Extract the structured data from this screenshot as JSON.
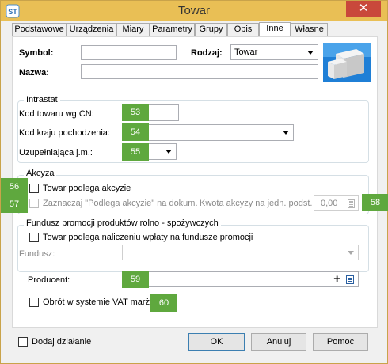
{
  "window": {
    "title": "Towar",
    "close_glyph": "✕",
    "app_icon": "app-logo-icon"
  },
  "tabs": [
    {
      "label": "Podstawowe"
    },
    {
      "label": "Urządzenia"
    },
    {
      "label": "Miary"
    },
    {
      "label": "Parametry"
    },
    {
      "label": "Grupy"
    },
    {
      "label": "Opis"
    },
    {
      "label": "Inne"
    },
    {
      "label": "Własne"
    }
  ],
  "active_tab": "Inne",
  "header": {
    "symbol_label": "Symbol:",
    "symbol_value": "",
    "nazwa_label": "Nazwa:",
    "nazwa_value": "",
    "rodzaj_label": "Rodzaj:",
    "rodzaj_value": "Towar",
    "product_icon": "product-boxes-icon"
  },
  "intrastat": {
    "title": "Intrastat",
    "cn_label": "Kod towaru wg CN:",
    "cn_value": "",
    "country_label": "Kod kraju pochodzenia:",
    "country_value": "",
    "unit_label": "Uzupełniająca j.m.:",
    "unit_value": ""
  },
  "akcyza": {
    "title": "Akcyza",
    "excise_checkbox_label": "Towar podlega akcyzie",
    "excise_checked": false,
    "mark_checkbox_label": "Zaznaczaj \"Podlega akcyzie\" na dokum.",
    "mark_checked": false,
    "amount_label": "Kwota akcyzy na jedn. podst.",
    "amount_value": "0,00"
  },
  "fundusz": {
    "title": "Fundusz promocji produktów rolno - spożywczych",
    "checkbox_label": "Towar podlega naliczeniu wpłaty na fundusze promocji",
    "checked": false,
    "fund_label": "Fundusz:",
    "fund_value": ""
  },
  "producent": {
    "label": "Producent:",
    "value": "",
    "add_glyph": "+"
  },
  "vat": {
    "checkbox_label": "Obrót w systemie VAT marża",
    "checked": false
  },
  "badges": [
    "53",
    "54",
    "55",
    "56",
    "57",
    "58",
    "59",
    "60"
  ],
  "footer": {
    "add_action_label": "Dodaj działanie",
    "add_action_checked": false,
    "ok_label": "OK",
    "cancel_label": "Anuluj",
    "help_label": "Pomoc"
  },
  "colors": {
    "titlebar": "#e9bf55",
    "close_button": "#c9483b",
    "badge": "#5fa83e"
  }
}
